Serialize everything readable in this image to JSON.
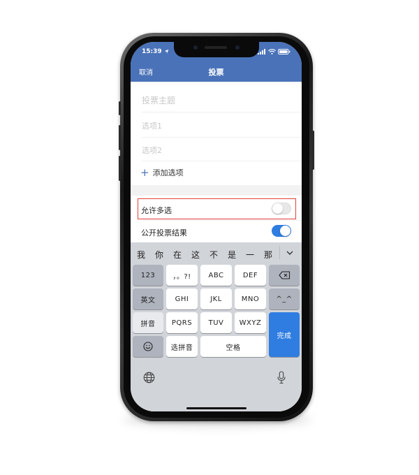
{
  "status": {
    "time": "15:39",
    "location_icon": "location-arrow-icon",
    "signal_icon": "signal-icon",
    "wifi_icon": "wifi-icon",
    "battery_icon": "battery-icon"
  },
  "nav": {
    "cancel_label": "取消",
    "title": "投票"
  },
  "form": {
    "topic_placeholder": "投票主题",
    "option1_placeholder": "选项1",
    "option2_placeholder": "选项2",
    "add_option_label": "添加选项",
    "allow_multi": {
      "label": "允许多选",
      "on": false
    },
    "public_results": {
      "label": "公开投票结果",
      "on": true
    }
  },
  "keyboard": {
    "candidates": [
      "我",
      "你",
      "在",
      "这",
      "不",
      "是",
      "一",
      "那"
    ],
    "keys": {
      "num": "123",
      "punct": "，。?!",
      "abc": "ABC",
      "def": "DEF",
      "english": "英文",
      "ghi": "GHI",
      "jkl": "JKL",
      "mno": "MNO",
      "emoticon": "^_^",
      "pinyin": "拼音",
      "pqrs": "PQRS",
      "tuv": "TUV",
      "wxyz": "WXYZ",
      "done": "完成",
      "select_pinyin": "选拼音",
      "space": "空格"
    }
  },
  "colors": {
    "header": "#4a72b8",
    "accent": "#2f7de1",
    "highlight_border": "#e0413a",
    "keyboard_bg": "#d1d4d9"
  }
}
